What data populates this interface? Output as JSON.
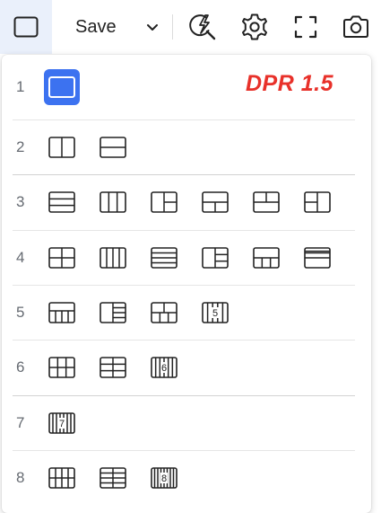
{
  "toolbar": {
    "save_label": "Save",
    "icons": [
      "layout-icon",
      "chevron-down-icon",
      "auto-analyze-icon",
      "gear-icon",
      "fullscreen-icon",
      "camera-icon"
    ]
  },
  "panel": {
    "watermark": "DPR 1.5",
    "selected": "1-1",
    "rows": [
      {
        "label": "1",
        "layouts": [
          "single"
        ]
      },
      {
        "label": "2",
        "layouts": [
          "split-vertical",
          "split-horizontal"
        ]
      },
      {
        "label": "3",
        "layouts": [
          "three-rows",
          "three-columns",
          "left-full-right-split",
          "top-full-bottom-split",
          "top-split-bottom-full",
          "left-split-right-full"
        ]
      },
      {
        "label": "4",
        "layouts": [
          "grid-2x2",
          "four-columns",
          "four-rows",
          "left-full-right-three",
          "top-full-bottom-three",
          "top-three-bottom-full"
        ]
      },
      {
        "label": "5",
        "layouts": [
          "top-full-bottom-four",
          "left-full-right-four",
          "top-two-bottom-three",
          "five-columns"
        ],
        "badges": {
          "3": "5"
        }
      },
      {
        "label": "6",
        "layouts": [
          "grid-3x2",
          "grid-2x3",
          "six-columns"
        ],
        "badges": {
          "2": "6"
        }
      },
      {
        "label": "7",
        "layouts": [
          "seven-columns"
        ],
        "badges": {
          "0": "7"
        }
      },
      {
        "label": "8",
        "layouts": [
          "grid-4x2",
          "grid-2x4",
          "eight-columns"
        ],
        "badges": {
          "2": "8"
        }
      }
    ]
  },
  "colors": {
    "accent": "#3c72f0",
    "toolbar_active_bg": "#eaf0fb",
    "watermark": "#e8312a",
    "icon_stroke": "#222222",
    "row_number": "#666b72"
  }
}
